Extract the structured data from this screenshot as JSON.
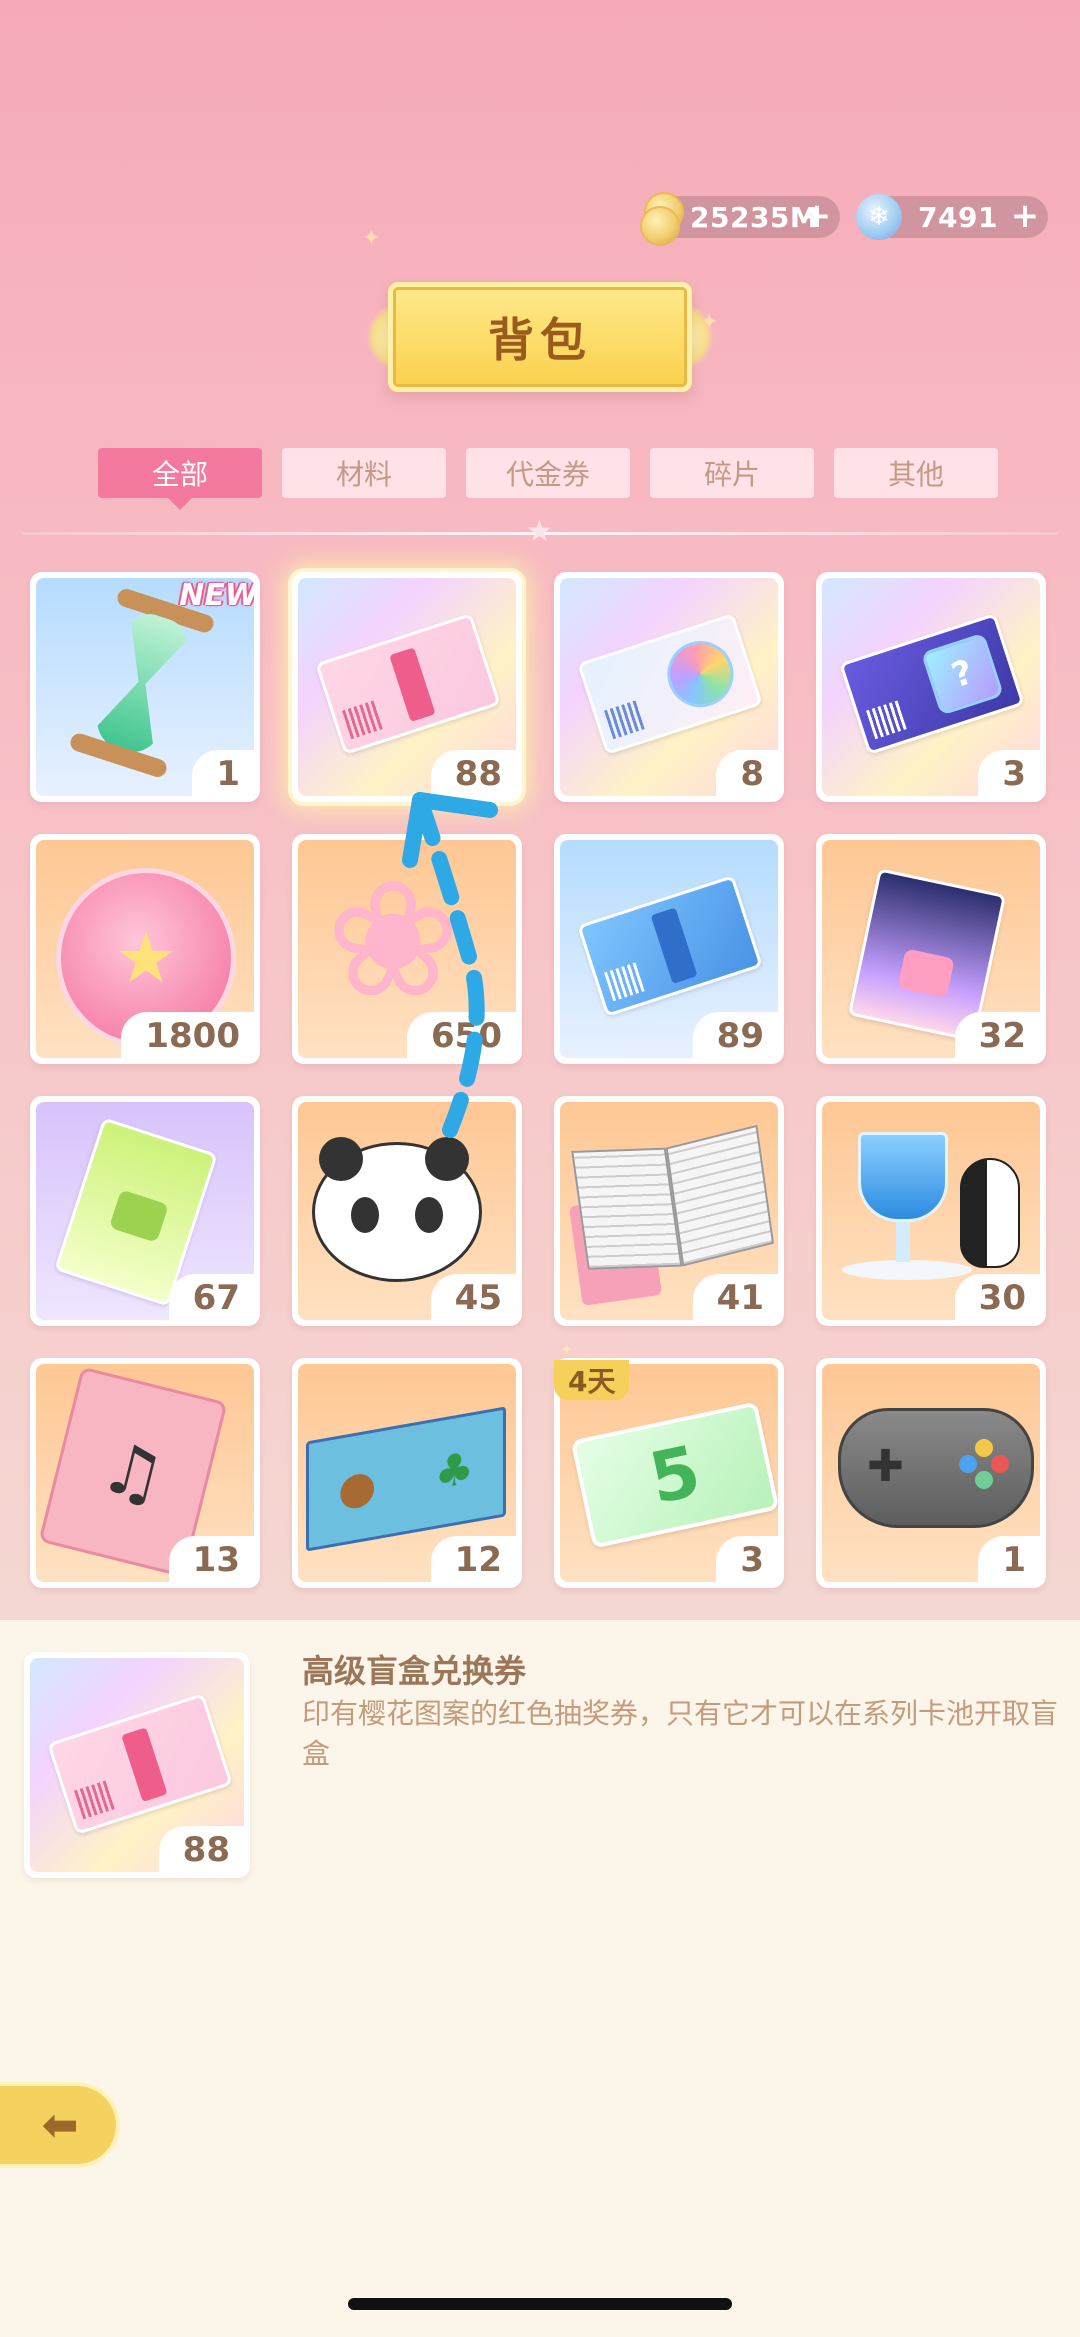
{
  "currency": {
    "coins": "25235M",
    "gems": "7491",
    "plus": "+"
  },
  "title": "背包",
  "tabs": [
    {
      "label": "全部",
      "active": true
    },
    {
      "label": "材料",
      "active": false
    },
    {
      "label": "代金券",
      "active": false
    },
    {
      "label": "碎片",
      "active": false
    },
    {
      "label": "其他",
      "active": false
    }
  ],
  "items": [
    {
      "icon": "hourglass-icon",
      "count": "1",
      "badge": "NEW",
      "bg": "blue"
    },
    {
      "icon": "premium-blind-box-ticket-icon",
      "count": "88",
      "selected": true,
      "bg": "rainbow"
    },
    {
      "icon": "character-ticket-icon",
      "count": "8",
      "bg": "rainbow"
    },
    {
      "icon": "mystery-ticket-icon",
      "count": "3",
      "bg": "rainbow"
    },
    {
      "icon": "pink-coin-icon",
      "count": "1800",
      "bg": "peach"
    },
    {
      "icon": "sakura-flower-icon",
      "count": "650",
      "bg": "peach"
    },
    {
      "icon": "blue-ticket-icon",
      "count": "89",
      "bg": "blue"
    },
    {
      "icon": "night-ticket-icon",
      "count": "32",
      "bg": "peach"
    },
    {
      "icon": "green-ticket-icon",
      "count": "67",
      "bg": "violet"
    },
    {
      "icon": "panda-plush-icon",
      "count": "45",
      "bg": "peach"
    },
    {
      "icon": "sketchbook-icon",
      "count": "41",
      "bg": "peach"
    },
    {
      "icon": "penguin-drink-icon",
      "count": "30",
      "bg": "peach"
    },
    {
      "icon": "music-notebook-icon",
      "count": "13",
      "bg": "peach"
    },
    {
      "icon": "puzzle-box-icon",
      "count": "12",
      "bg": "peach"
    },
    {
      "icon": "sale-coupon-icon",
      "count": "3",
      "badge": "4天",
      "bg": "peach"
    },
    {
      "icon": "gamepad-icon",
      "count": "1",
      "bg": "peach"
    }
  ],
  "detail": {
    "name": "高级盲盒兑换券",
    "description": "印有樱花图案的红色抽奖券，只有它才可以在系列卡池开取盲盒",
    "count": "88"
  },
  "glyphs": {
    "new": "NEW",
    "coupon_number": "5",
    "note": "♫",
    "question": "?",
    "flower": "❀",
    "star": "★",
    "dpad": "✚",
    "back": "⬅"
  },
  "colors": {
    "active_tab": "#f3799e",
    "count_text": "#8a6a52",
    "title_text": "#9b5b1e"
  }
}
